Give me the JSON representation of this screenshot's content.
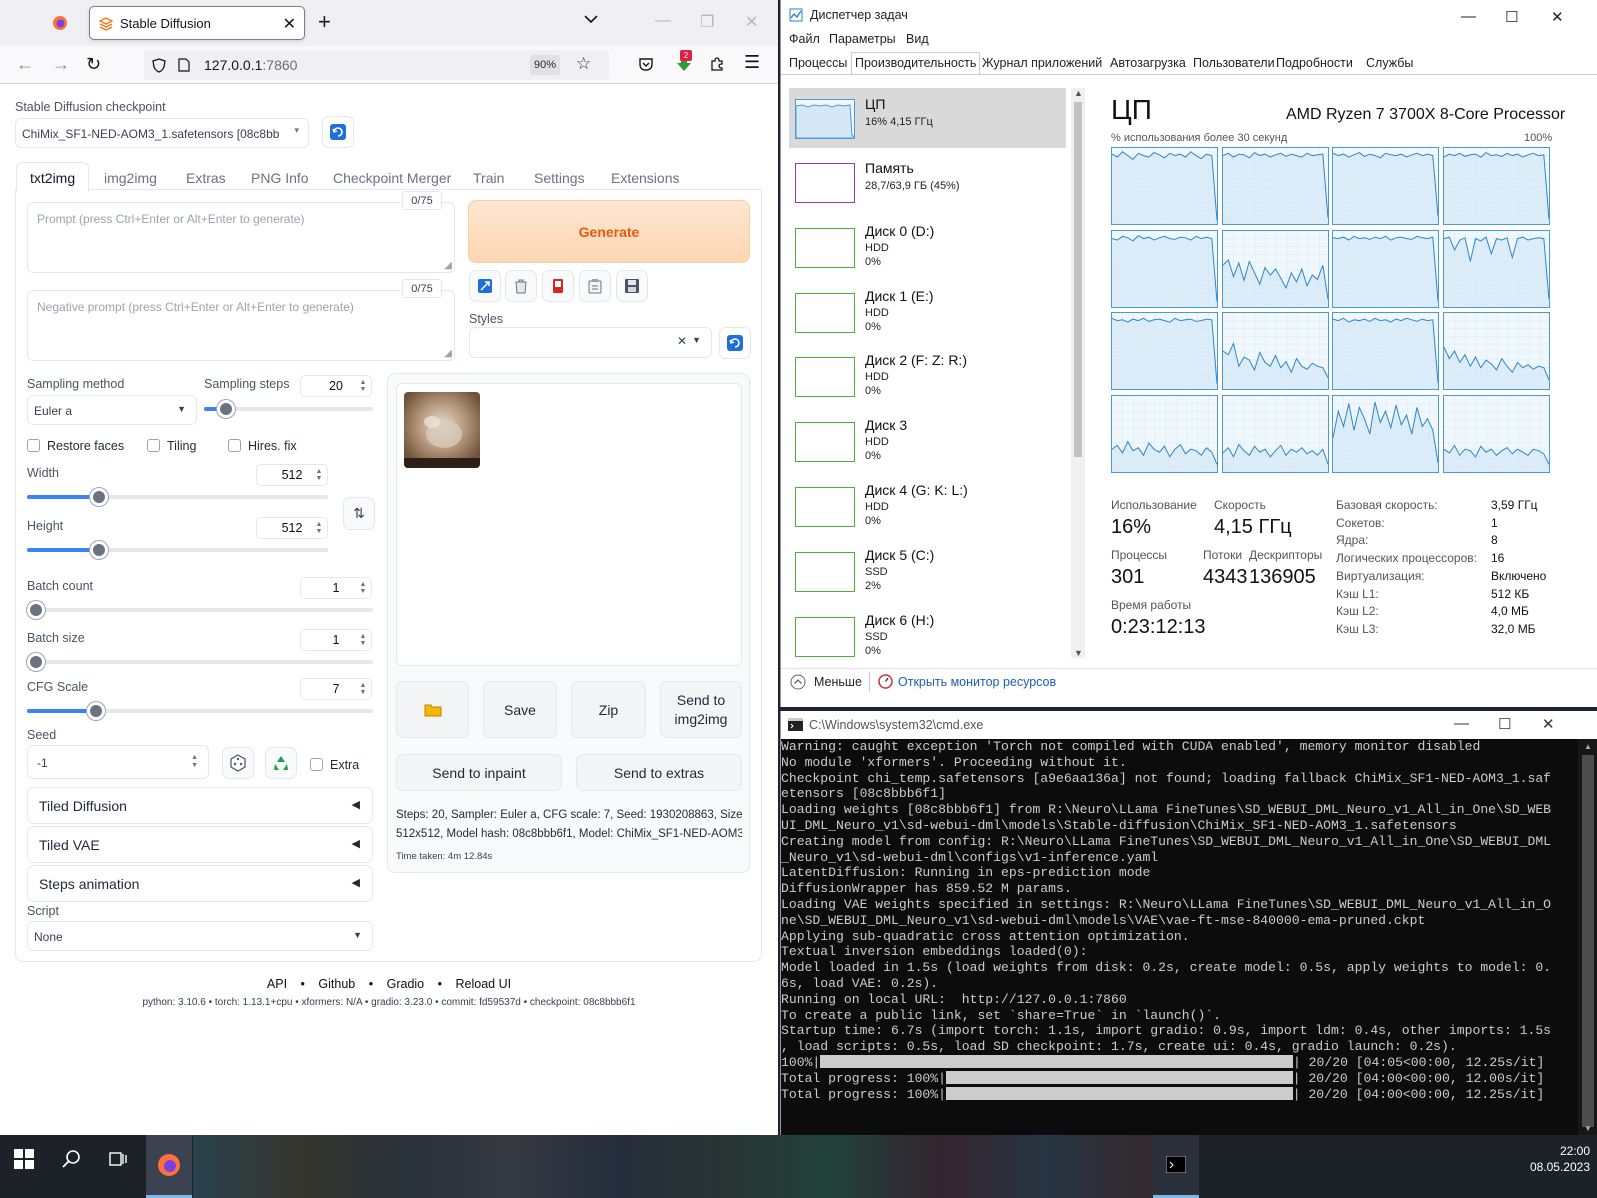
{
  "firefox": {
    "tab_title": "Stable Diffusion",
    "url_host": "127.0.0.1",
    "url_port": ":7860",
    "zoom": "90%",
    "notification_badge": "2"
  },
  "sd": {
    "checkpoint_label": "Stable Diffusion checkpoint",
    "checkpoint_value": "ChiMix_SF1-NED-AOM3_1.safetensors [08c8bbb6f",
    "tabs": [
      "txt2img",
      "img2img",
      "Extras",
      "PNG Info",
      "Checkpoint Merger",
      "Train",
      "Settings",
      "Extensions"
    ],
    "prompt_counter": "0/75",
    "prompt_placeholder": "Prompt (press Ctrl+Enter or Alt+Enter to generate)",
    "neg_counter": "0/75",
    "neg_placeholder": "Negative prompt (press Ctrl+Enter or Alt+Enter to generate)",
    "generate": "Generate",
    "styles_label": "Styles",
    "sampling_method_label": "Sampling method",
    "sampling_method": "Euler a",
    "sampling_steps_label": "Sampling steps",
    "sampling_steps": "20",
    "sampling_steps_frac": 0.13,
    "restore_faces": "Restore faces",
    "tiling": "Tiling",
    "hires_fix": "Hires. fix",
    "width_label": "Width",
    "width": "512",
    "width_frac": 0.24,
    "height_label": "Height",
    "height": "512",
    "height_frac": 0.24,
    "batch_count_label": "Batch count",
    "batch_count": "1",
    "batch_size_label": "Batch size",
    "batch_size": "1",
    "cfg_label": "CFG Scale",
    "cfg": "7",
    "cfg_frac": 0.2,
    "seed_label": "Seed",
    "seed": "-1",
    "extra": "Extra",
    "accordions": [
      "Tiled Diffusion",
      "Tiled VAE",
      "Steps animation"
    ],
    "script_label": "Script",
    "script": "None",
    "save": "Save",
    "zip": "Zip",
    "send_img2img": "Send to img2img",
    "send_inpaint": "Send to inpaint",
    "send_extras": "Send to extras",
    "info_line1": "Steps: 20, Sampler: Euler a, CFG scale: 7, Seed: 1930208863, Size:",
    "info_line2": "512x512, Model hash: 08c8bbb6f1, Model: ChiMix_SF1-NED-AOM3_1",
    "time_taken": "Time taken: 4m 12.84s",
    "footer_links": [
      "API",
      "Github",
      "Gradio",
      "Reload UI"
    ],
    "footer_version": "python: 3.10.6  •  torch: 1.13.1+cpu  •  xformers: N/A  •  gradio: 3.23.0  •  commit: fd59537d  •  checkpoint: 08c8bbb6f1"
  },
  "taskmgr": {
    "title": "Диспетчер задач",
    "menu": [
      "Файл",
      "Параметры",
      "Вид"
    ],
    "tabs": [
      "Процессы",
      "Производительность",
      "Журнал приложений",
      "Автозагрузка",
      "Пользователи",
      "Подробности",
      "Службы"
    ],
    "side": [
      {
        "name": "ЦП",
        "s1": "16% 4,15 ГГц",
        "s2": "",
        "color": "#4a9ad6"
      },
      {
        "name": "Память",
        "s1": "28,7/63,9 ГБ (45%)",
        "s2": "",
        "color": "#8b3fb0"
      },
      {
        "name": "Диск 0 (D:)",
        "s1": "HDD",
        "s2": "0%",
        "color": "#4caf3a"
      },
      {
        "name": "Диск 1 (E:)",
        "s1": "HDD",
        "s2": "0%",
        "color": "#4caf3a"
      },
      {
        "name": "Диск 2 (F: Z: R:)",
        "s1": "HDD",
        "s2": "0%",
        "color": "#4caf3a"
      },
      {
        "name": "Диск 3",
        "s1": "HDD",
        "s2": "0%",
        "color": "#4caf3a"
      },
      {
        "name": "Диск 4 (G: K: L:)",
        "s1": "HDD",
        "s2": "0%",
        "color": "#4caf3a"
      },
      {
        "name": "Диск 5 (C:)",
        "s1": "SSD",
        "s2": "2%",
        "color": "#4caf3a"
      },
      {
        "name": "Диск 6 (H:)",
        "s1": "SSD",
        "s2": "0%",
        "color": "#4caf3a"
      }
    ],
    "cpu_title": "ЦП",
    "cpu_model": "AMD Ryzen 7 3700X 8-Core Processor",
    "graph_caption": "% использования более 30 секунд",
    "graph_max": "100%",
    "usage_label": "Использование",
    "usage": "16%",
    "speed_label": "Скорость",
    "speed": "4,15 ГГц",
    "proc_label": "Процессы",
    "proc": "301",
    "threads_label": "Потоки",
    "threads": "4343",
    "handles_label": "Дескрипторы",
    "handles": "136905",
    "uptime_label": "Время работы",
    "uptime": "0:23:12:13",
    "kv": [
      [
        "Базовая скорость:",
        "3,59 ГГц"
      ],
      [
        "Сокетов:",
        "1"
      ],
      [
        "Ядра:",
        "8"
      ],
      [
        "Логических процессоров:",
        "16"
      ],
      [
        "Виртуализация:",
        "Включено"
      ],
      [
        "Кэш L1:",
        "512 КБ"
      ],
      [
        "Кэш L2:",
        "4,0 МБ"
      ],
      [
        "Кэш L3:",
        "32,0 МБ"
      ]
    ],
    "less": "Меньше",
    "resmon": "Открыть монитор ресурсов",
    "cpu_graphs": [
      [
        0.92,
        0.88,
        0.95,
        0.9,
        0.85,
        0.93,
        0.9,
        0.88,
        0.94,
        0.91,
        0.87,
        0.93,
        0.9,
        0.92,
        0.88,
        0.95,
        0.9,
        0.86,
        0.92,
        0.9,
        0.05
      ],
      [
        0.9,
        0.93,
        0.88,
        0.92,
        0.91,
        0.87,
        0.94,
        0.9,
        0.92,
        0.88,
        0.91,
        0.93,
        0.89,
        0.92,
        0.9,
        0.88,
        0.93,
        0.9,
        0.91,
        0.92,
        0.08
      ],
      [
        0.93,
        0.9,
        0.92,
        0.88,
        0.91,
        0.94,
        0.89,
        0.92,
        0.9,
        0.87,
        0.93,
        0.91,
        0.9,
        0.92,
        0.88,
        0.91,
        0.93,
        0.9,
        0.92,
        0.9,
        0.1
      ],
      [
        0.88,
        0.92,
        0.9,
        0.93,
        0.89,
        0.91,
        0.92,
        0.88,
        0.94,
        0.9,
        0.91,
        0.89,
        0.93,
        0.9,
        0.92,
        0.88,
        0.91,
        0.93,
        0.9,
        0.91,
        0.06
      ],
      [
        0.9,
        0.88,
        0.93,
        0.91,
        0.87,
        0.94,
        0.9,
        0.92,
        0.88,
        0.91,
        0.93,
        0.9,
        0.89,
        0.92,
        0.91,
        0.88,
        0.93,
        0.9,
        0.92,
        0.9,
        0.07
      ],
      [
        0.55,
        0.62,
        0.4,
        0.58,
        0.35,
        0.6,
        0.45,
        0.3,
        0.52,
        0.42,
        0.5,
        0.38,
        0.25,
        0.45,
        0.33,
        0.5,
        0.28,
        0.42,
        0.36,
        0.55,
        0.1
      ],
      [
        0.91,
        0.9,
        0.92,
        0.88,
        0.93,
        0.9,
        0.91,
        0.89,
        0.92,
        0.9,
        0.93,
        0.88,
        0.91,
        0.92,
        0.9,
        0.89,
        0.93,
        0.91,
        0.9,
        0.92,
        0.08
      ],
      [
        0.9,
        0.92,
        0.75,
        0.88,
        0.91,
        0.6,
        0.9,
        0.87,
        0.92,
        0.7,
        0.9,
        0.88,
        0.91,
        0.65,
        0.9,
        0.92,
        0.88,
        0.9,
        0.91,
        0.9,
        0.1
      ],
      [
        0.93,
        0.9,
        0.91,
        0.88,
        0.92,
        0.9,
        0.93,
        0.89,
        0.91,
        0.92,
        0.9,
        0.88,
        0.93,
        0.9,
        0.91,
        0.92,
        0.89,
        0.9,
        0.92,
        0.91,
        0.07
      ],
      [
        0.5,
        0.45,
        0.6,
        0.3,
        0.42,
        0.38,
        0.25,
        0.48,
        0.35,
        0.3,
        0.44,
        0.28,
        0.36,
        0.22,
        0.4,
        0.3,
        0.26,
        0.34,
        0.3,
        0.28,
        0.15
      ],
      [
        0.92,
        0.9,
        0.93,
        0.88,
        0.91,
        0.9,
        0.92,
        0.89,
        0.93,
        0.9,
        0.91,
        0.88,
        0.92,
        0.9,
        0.93,
        0.91,
        0.89,
        0.92,
        0.9,
        0.91,
        0.08
      ],
      [
        0.55,
        0.4,
        0.5,
        0.35,
        0.45,
        0.3,
        0.42,
        0.28,
        0.38,
        0.33,
        0.25,
        0.4,
        0.3,
        0.22,
        0.35,
        0.28,
        0.32,
        0.26,
        0.3,
        0.28,
        0.12
      ],
      [
        0.3,
        0.35,
        0.25,
        0.4,
        0.28,
        0.32,
        0.22,
        0.38,
        0.3,
        0.26,
        0.34,
        0.2,
        0.3,
        0.36,
        0.24,
        0.3,
        0.28,
        0.22,
        0.32,
        0.26,
        0.1
      ],
      [
        0.25,
        0.32,
        0.2,
        0.36,
        0.28,
        0.22,
        0.34,
        0.26,
        0.3,
        0.2,
        0.28,
        0.35,
        0.22,
        0.3,
        0.26,
        0.32,
        0.24,
        0.28,
        0.22,
        0.3,
        0.1
      ],
      [
        0.45,
        0.8,
        0.6,
        0.9,
        0.55,
        0.85,
        0.7,
        0.5,
        0.92,
        0.65,
        0.8,
        0.58,
        0.88,
        0.62,
        0.75,
        0.5,
        0.85,
        0.6,
        0.7,
        0.55,
        0.12
      ],
      [
        0.3,
        0.25,
        0.35,
        0.22,
        0.3,
        0.28,
        0.2,
        0.34,
        0.26,
        0.3,
        0.22,
        0.28,
        0.32,
        0.24,
        0.3,
        0.26,
        0.22,
        0.3,
        0.28,
        0.24,
        0.1
      ]
    ]
  },
  "cmd": {
    "title": "C:\\Windows\\system32\\cmd.exe",
    "lines": [
      "Warning: caught exception 'Torch not compiled with CUDA enabled', memory monitor disabled",
      "No module 'xformers'. Proceeding without it.",
      "Checkpoint chi_temp.safetensors [a9e6aa136a] not found; loading fallback ChiMix_SF1-NED-AOM3_1.saf",
      "etensors [08c8bbb6f1]",
      "Loading weights [08c8bbb6f1] from R:\\Neuro\\LLama FineTunes\\SD_WEBUI_DML_Neuro_v1_All_in_One\\SD_WEB",
      "UI_DML_Neuro_v1\\sd-webui-dml\\models\\Stable-diffusion\\ChiMix_SF1-NED-AOM3_1.safetensors",
      "Creating model from config: R:\\Neuro\\LLama FineTunes\\SD_WEBUI_DML_Neuro_v1_All_in_One\\SD_WEBUI_DML",
      "_Neuro_v1\\sd-webui-dml\\configs\\v1-inference.yaml",
      "LatentDiffusion: Running in eps-prediction mode",
      "DiffusionWrapper has 859.52 M params.",
      "Loading VAE weights specified in settings: R:\\Neuro\\LLama FineTunes\\SD_WEBUI_DML_Neuro_v1_All_in_O",
      "ne\\SD_WEBUI_DML_Neuro_v1\\sd-webui-dml\\models\\VAE\\vae-ft-mse-840000-ema-pruned.ckpt",
      "Applying sub-quadratic cross attention optimization.",
      "Textual inversion embeddings loaded(0):",
      "Model loaded in 1.5s (load weights from disk: 0.2s, create model: 0.5s, apply weights to model: 0.",
      "6s, load VAE: 0.2s).",
      "Running on local URL:  http://127.0.0.1:7860",
      "",
      "To create a public link, set `share=True` in `launch()`.",
      "Startup time: 6.7s (import torch: 1.1s, import gradio: 0.9s, import ldm: 0.4s, other imports: 1.5s",
      ", load scripts: 0.5s, load SD checkpoint: 1.7s, create ui: 0.4s, gradio launch: 0.2s)."
    ],
    "progress": [
      {
        "prefix": "100%|",
        "suffix": "| 20/20 [04:05<00:00, 12.25s/it]",
        "value": 1.0
      },
      {
        "prefix": "Total progress: 100%|",
        "suffix": "| 20/20 [04:00<00:00, 12.00s/it]",
        "value": 1.0
      },
      {
        "prefix": "Total progress: 100%|",
        "suffix": "| 20/20 [04:00<00:00, 12.25s/it]",
        "value": 1.0
      }
    ]
  },
  "taskbar": {
    "time": "22:00",
    "date": "08.05.2023"
  }
}
